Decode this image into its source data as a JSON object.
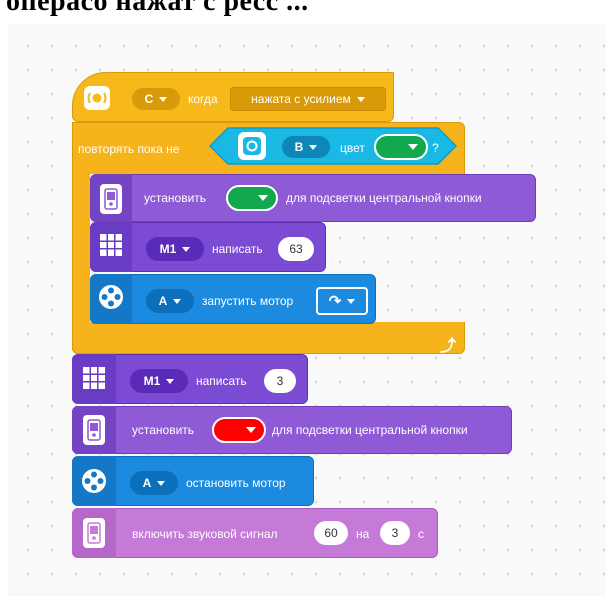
{
  "header": {
    "caption": "операсо нажат с ресс ..."
  },
  "colors": {
    "event_yellow": "#f7b81a",
    "control_orange": "#f6b31b",
    "sensor_cyan": "#1ab8e4",
    "display_purple": "#7b4bd4",
    "light_purple": "#8e5ad6",
    "motor_blue": "#1c8bdf",
    "sound_purple": "#c67ad8",
    "green": "#11a84e",
    "red": "#ff0000"
  },
  "hat_block": {
    "icon": "hub-button-icon",
    "button_dropdown": "C",
    "when_label": "когда",
    "event_dropdown": "нажата с усилием"
  },
  "repeat_block": {
    "label": "повторять пока не",
    "condition": {
      "sensor_icon": "color-sensor-icon",
      "port_dropdown": "B",
      "color_label": "цвет",
      "color_value": "green",
      "question": "?"
    },
    "loop_arrow_icon": "loop-return-icon"
  },
  "inner_blocks": [
    {
      "type": "light",
      "icon": "hub-light-icon",
      "label_set": "установить",
      "color_value": "green",
      "label_rest": "для подсветки центральной кнопки"
    },
    {
      "type": "display",
      "icon": "matrix-icon",
      "port": "M1",
      "label": "написать",
      "value": "63"
    },
    {
      "type": "motor",
      "icon": "motor-icon",
      "port": "A",
      "label": "запустить мотор",
      "direction_icon": "clockwise-arrow-icon"
    }
  ],
  "after_blocks": [
    {
      "type": "display",
      "icon": "matrix-icon",
      "port": "M1",
      "label": "написать",
      "value": "3"
    },
    {
      "type": "light",
      "icon": "hub-light-icon",
      "label_set": "установить",
      "color_value": "red",
      "label_rest": "для подсветки центральной кнопки"
    },
    {
      "type": "motor",
      "icon": "motor-icon",
      "port": "A",
      "label": "остановить мотор"
    },
    {
      "type": "sound",
      "icon": "hub-sound-icon",
      "label": "включить звуковой сигнал",
      "value": "60",
      "label_on": "на",
      "duration": "3",
      "unit": "с"
    }
  ]
}
